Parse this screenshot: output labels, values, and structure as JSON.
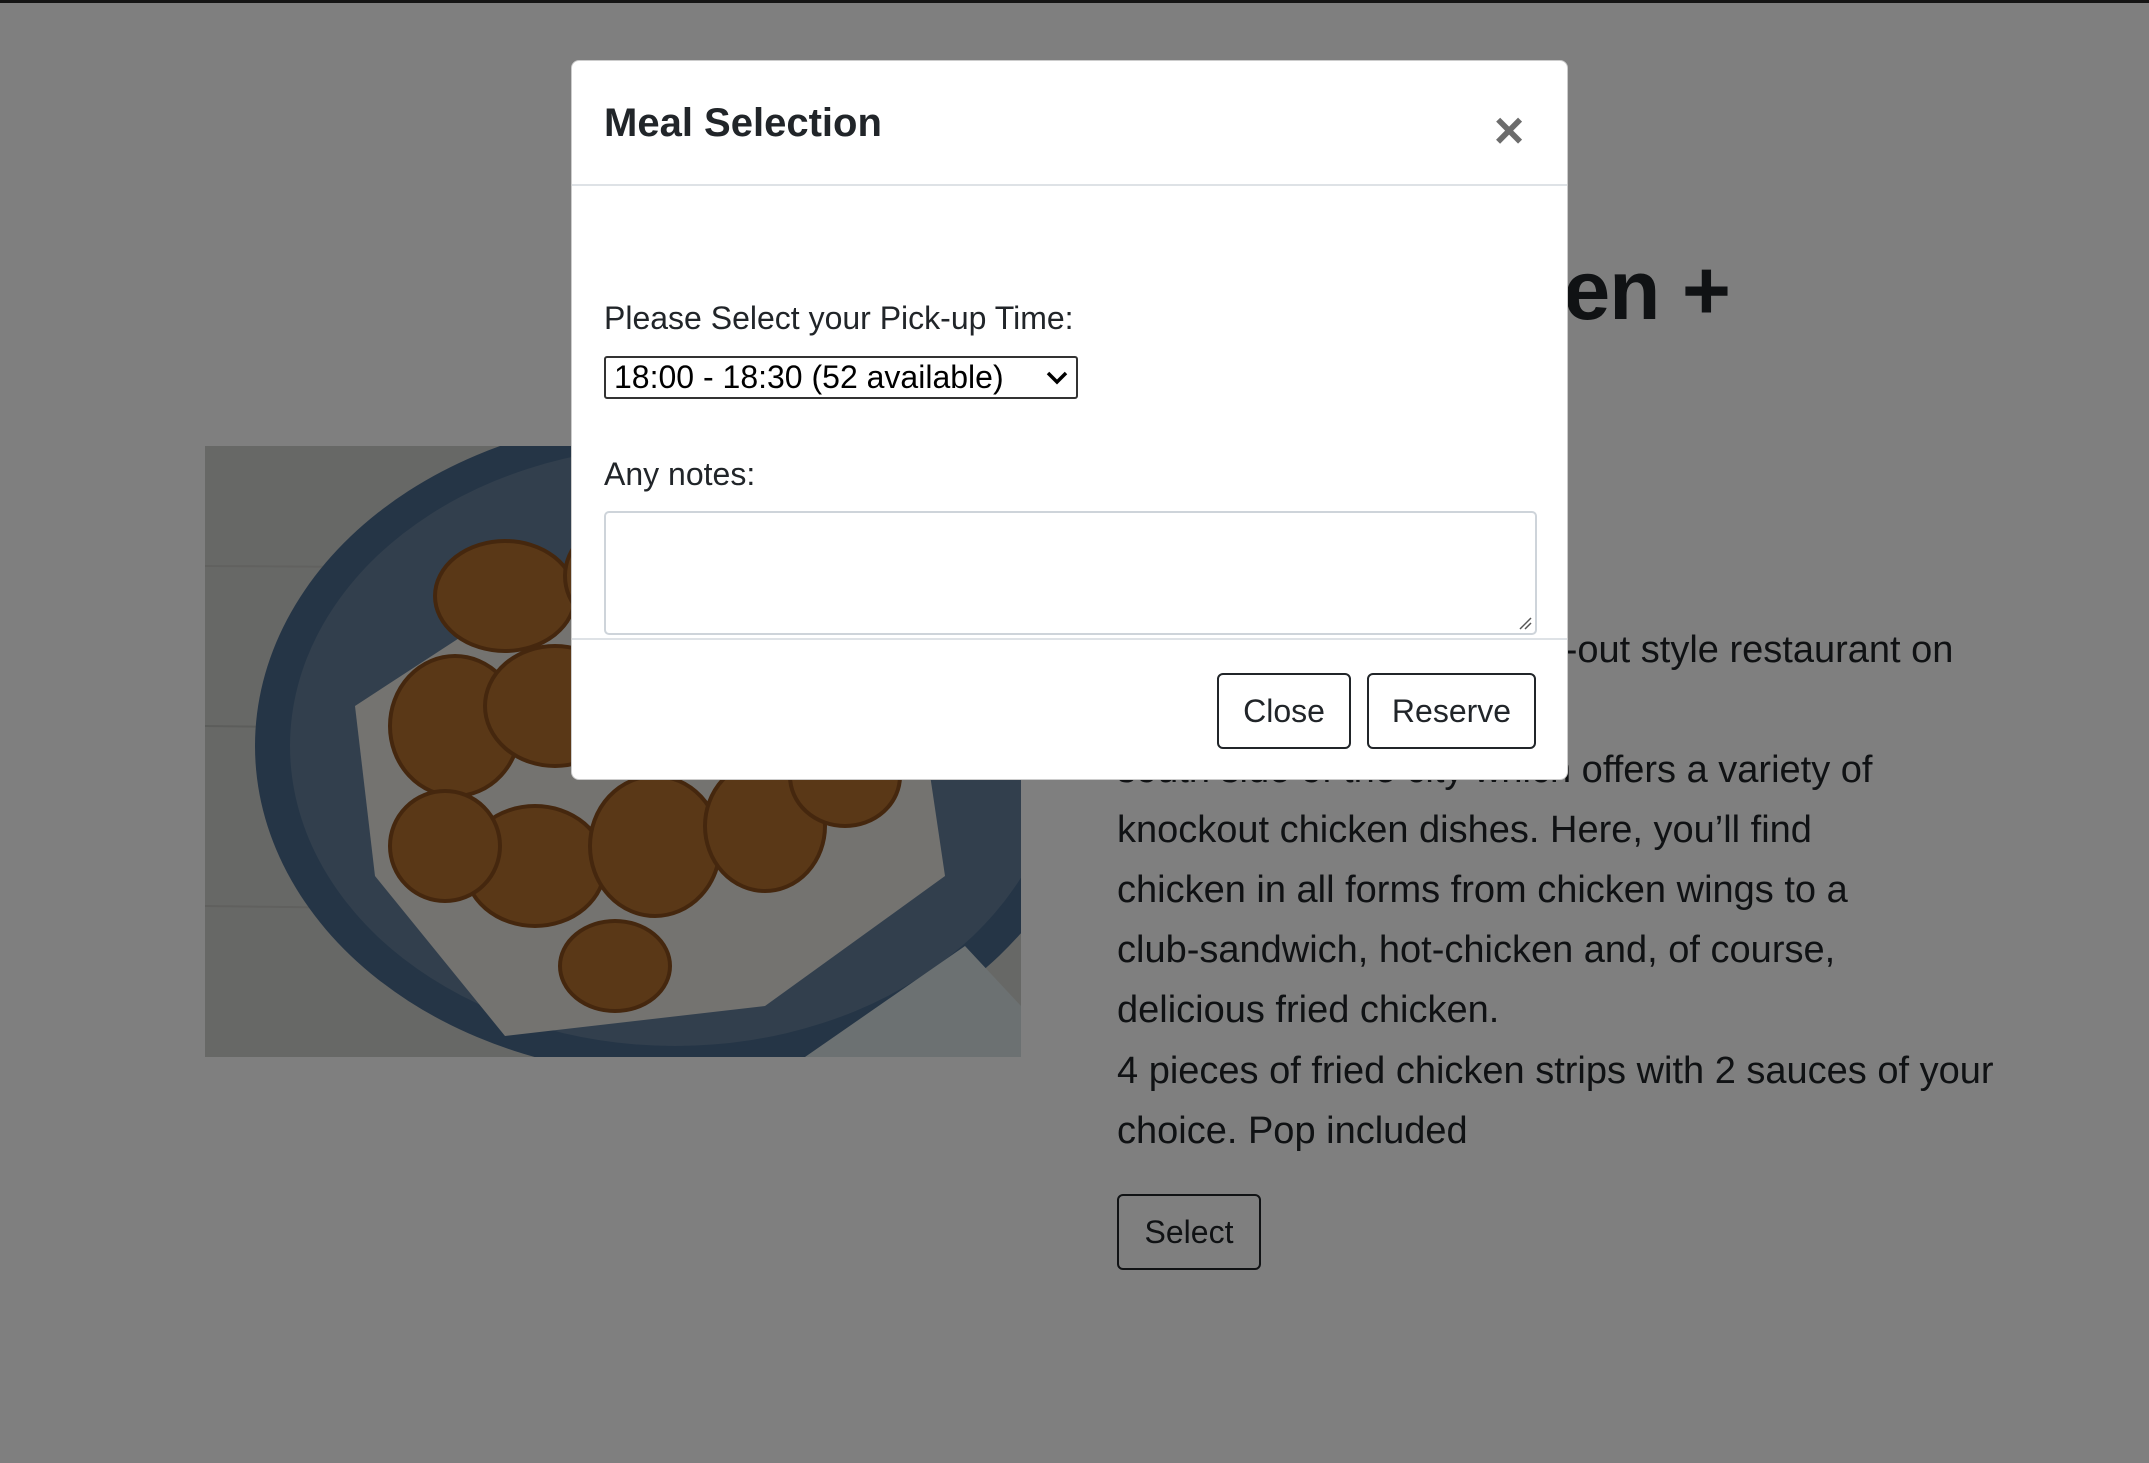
{
  "product": {
    "title": "Fried Chicken +",
    "description": "Fried Chicken is a hip take-out style restaurant on the\nsouth side of the city which offers a variety of\nknockout chicken dishes. Here, you’ll find\nchicken in all forms from chicken wings to a\nclub-sandwich, hot-chicken and, of course,\ndelicious fried chicken.",
    "detail": "4 pieces of fried chicken strips with 2 sauces of your choice. Pop included",
    "select_label": "Select",
    "image_icon": "fried-chicken-plate"
  },
  "modal": {
    "title": "Meal Selection",
    "close_icon": "close-icon",
    "pickup_label": "Please Select your Pick-up Time:",
    "pickup_selected": "18:00 - 18:30 (52 available)",
    "notes_label": "Any notes:",
    "notes_value": "",
    "close_label": "Close",
    "reserve_label": "Reserve"
  },
  "colors": {
    "backdrop": "#000000",
    "text": "#212529",
    "plate": "#5e7f9e",
    "chicken": "#b8732f"
  }
}
